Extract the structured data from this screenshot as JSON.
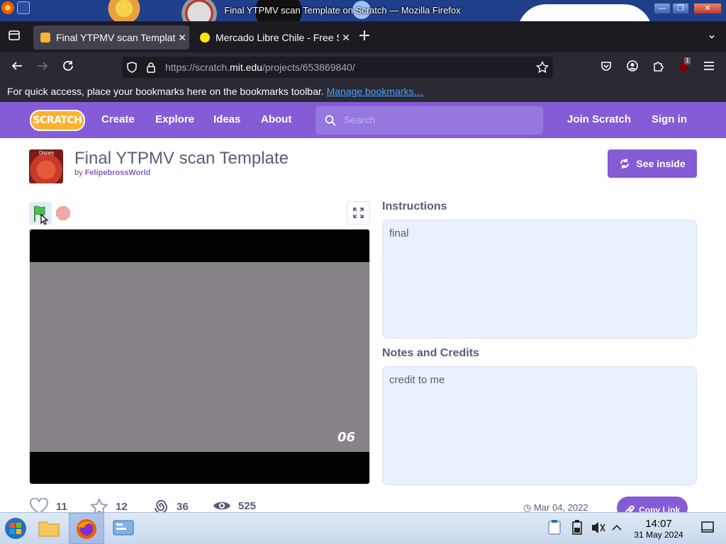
{
  "window": {
    "title": "Final YTPMV scan Template on Scratch — Mozilla Firefox",
    "buttons": {
      "minimize": "—",
      "maximize": "❐",
      "close": "✕"
    }
  },
  "tabs": [
    {
      "label": "Final YTPMV scan Template on Scratch",
      "active": true,
      "close": "✕"
    },
    {
      "label": "Mercado Libre Chile - Free Shipping",
      "active": false,
      "close": "✕"
    }
  ],
  "tabbar": {
    "new_tab": "+",
    "list_all": "⌄"
  },
  "urlbar": {
    "url_prefix": "https://scratch.",
    "url_domain": "mit.edu",
    "url_suffix": "/projects/653869840/"
  },
  "bookmarks_bar": {
    "text": "For quick access, place your bookmarks here on the bookmarks toolbar.",
    "link": "Manage bookmarks…"
  },
  "extension_badge": "1",
  "scratch_nav": {
    "logo": "SCRATCH",
    "items": [
      "Create",
      "Explore",
      "Ideas",
      "About"
    ],
    "search_placeholder": "Search",
    "join": "Join Scratch",
    "signin": "Sign in"
  },
  "project": {
    "thumb_text": "Disney",
    "title": "Final YTPMV scan Template",
    "by": "by",
    "author": "FelipebrossWorld",
    "see_inside": "See inside",
    "stage_counter": "06"
  },
  "instructions": {
    "heading": "Instructions",
    "text": "final"
  },
  "notes": {
    "heading": "Notes and Credits",
    "text": "credit to me"
  },
  "stats": {
    "loves": "11",
    "favorites": "12",
    "remixes": "36",
    "views": "525"
  },
  "date": "Mar 04, 2022",
  "copy_link": "Copy Link",
  "taskbar": {
    "time": "14:07",
    "date": "31 May 2024"
  },
  "colors": {
    "scratch_purple": "#855cd6",
    "firefox_dark": "#1c1b22",
    "instructions_bg": "#e9f1fc"
  }
}
